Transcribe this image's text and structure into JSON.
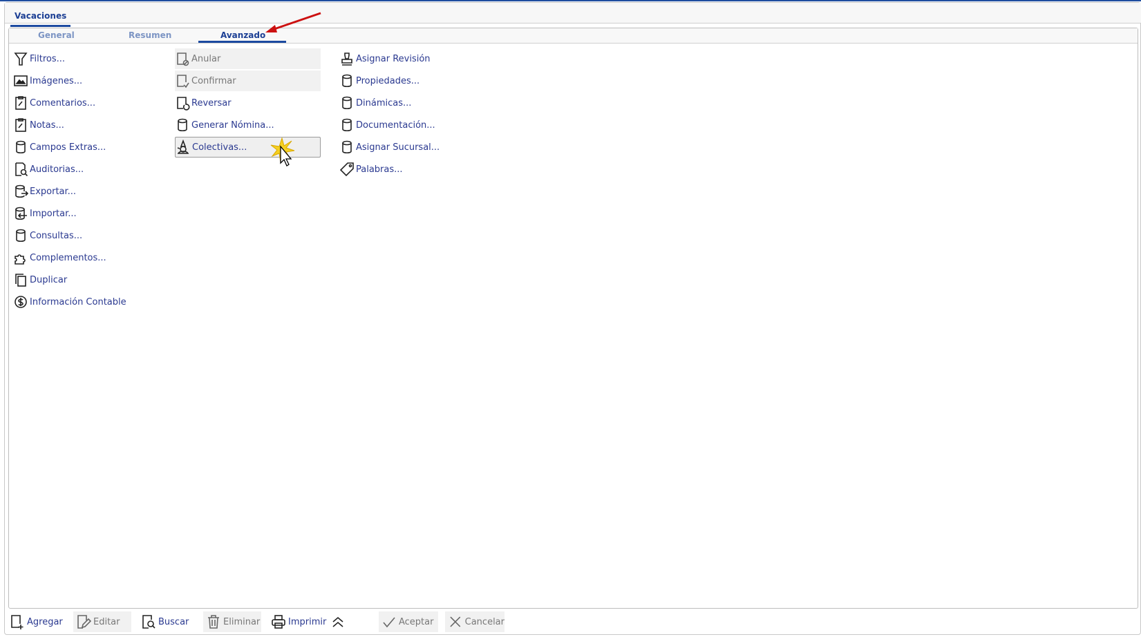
{
  "window": {
    "tab": "Vacaciones"
  },
  "subtabs": [
    "General",
    "Resumen",
    "Avanzado"
  ],
  "active_subtab": "Avanzado",
  "col1": [
    {
      "label": "Filtros...",
      "icon": "filter-icon"
    },
    {
      "label": "Imágenes...",
      "icon": "image-icon"
    },
    {
      "label": "Comentarios...",
      "icon": "clipboard-edit-icon"
    },
    {
      "label": "Notas...",
      "icon": "clipboard-edit-icon"
    },
    {
      "label": "Campos Extras...",
      "icon": "database-icon"
    },
    {
      "label": "Auditorias...",
      "icon": "audit-icon"
    },
    {
      "label": "Exportar...",
      "icon": "database-export-icon"
    },
    {
      "label": "Importar...",
      "icon": "database-import-icon"
    },
    {
      "label": "Consultas...",
      "icon": "database-icon"
    },
    {
      "label": "Complementos...",
      "icon": "puzzle-icon"
    },
    {
      "label": "Duplicar",
      "icon": "copy-icon"
    },
    {
      "label": "Información Contable",
      "icon": "dollar-icon"
    }
  ],
  "col2": [
    {
      "label": "Anular",
      "icon": "document-cancel-icon",
      "state": "disabled"
    },
    {
      "label": "Confirmar",
      "icon": "document-check-icon",
      "state": "disabled"
    },
    {
      "label": "Reversar",
      "icon": "document-undo-icon",
      "state": "normal"
    },
    {
      "label": "Generar Nómina...",
      "icon": "database-icon",
      "state": "normal"
    },
    {
      "label": "Colectivas...",
      "icon": "wizard-icon",
      "state": "hovered"
    }
  ],
  "col3": [
    {
      "label": "Asignar Revisión",
      "icon": "stamp-icon"
    },
    {
      "label": "Propiedades...",
      "icon": "database-icon"
    },
    {
      "label": "Dinámicas...",
      "icon": "database-icon"
    },
    {
      "label": "Documentación...",
      "icon": "database-icon"
    },
    {
      "label": "Asignar Sucursal...",
      "icon": "database-icon"
    },
    {
      "label": "Palabras...",
      "icon": "tag-icon"
    }
  ],
  "toolbar": [
    {
      "label": "Agregar",
      "icon": "add-document-icon",
      "state": "normal"
    },
    {
      "label": "Editar",
      "icon": "edit-icon",
      "state": "disabled"
    },
    {
      "label": "Buscar",
      "icon": "search-document-icon",
      "state": "normal"
    },
    {
      "label": "Eliminar",
      "icon": "trash-icon",
      "state": "disabled"
    },
    {
      "label": "Imprimir",
      "icon": "printer-icon",
      "state": "normal"
    },
    {
      "label": "Aceptar",
      "icon": "check-icon",
      "state": "disabled"
    },
    {
      "label": "Cancelar",
      "icon": "close-icon",
      "state": "disabled"
    }
  ],
  "colors": {
    "link": "#2a3990",
    "accent": "#1c4aa0",
    "disabled": "#777777",
    "annotation": "#cc1111"
  }
}
